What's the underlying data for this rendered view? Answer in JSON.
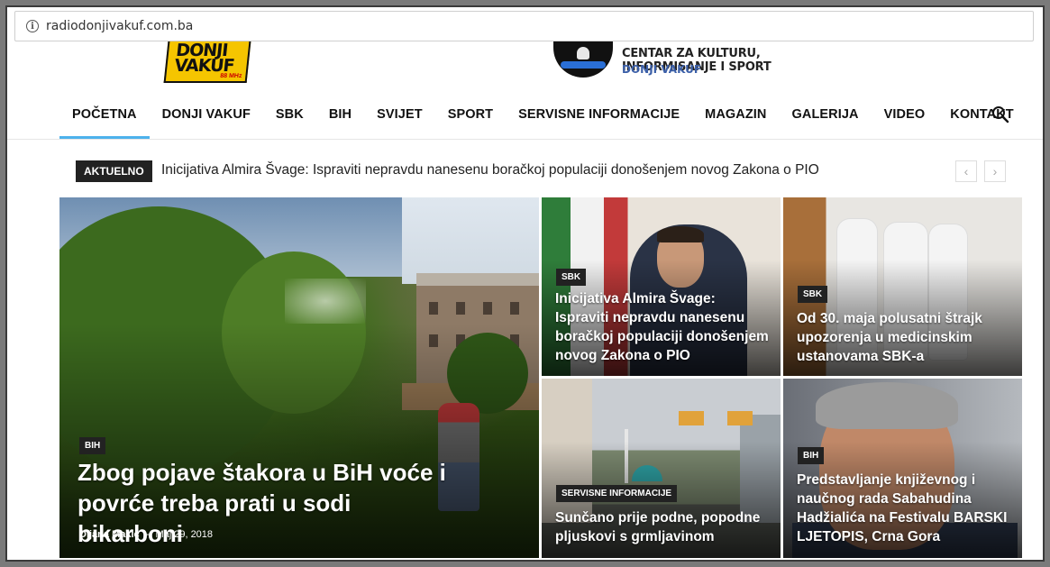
{
  "browser": {
    "url": "radiodonjivakuf.com.ba"
  },
  "header": {
    "logo_left": {
      "line1": "DONJI",
      "line2": "VAKUF",
      "freq": "88 MHz"
    },
    "logo_right": {
      "line1": "CENTAR ZA KULTURU, INFORMISANJE I SPORT",
      "line2": "DONJI VAKUF"
    }
  },
  "nav": {
    "items": [
      "POČETNA",
      "DONJI VAKUF",
      "SBK",
      "BIH",
      "SVIJET",
      "SPORT",
      "SERVISNE INFORMACIJE",
      "MAGAZIN",
      "GALERIJA",
      "VIDEO",
      "KONTAKT"
    ],
    "active": "POČETNA",
    "search_icon": "search-icon"
  },
  "ticker": {
    "badge": "AKTUELNO",
    "text": "Inicijativa Almira Švage: Ispraviti nepravdu nanesenu boračkoj populaciji donošenjem novog Zakona o PIO",
    "prev": "‹",
    "next": "›"
  },
  "articles": [
    {
      "category": "BIH",
      "title": "Zbog pojave štakora u BiH voće i povrće treba prati u sodi bikarboni",
      "author": "Dijana Makić",
      "separator": "-",
      "date": "Maj 29, 2018"
    },
    {
      "category": "SBK",
      "title": "Inicijativa Almira Švage: Ispraviti nepravdu nanesenu boračkoj populaciji donošenjem novog Zakona o PIO"
    },
    {
      "category": "SBK",
      "title": "Od 30. maja polusatni štrajk upozorenja u medicinskim ustanovama SBK-a"
    },
    {
      "category": "SERVISNE INFORMACIJE",
      "title": "Sunčano prije podne, popodne pljuskovi s grmljavinom"
    },
    {
      "category": "BIH",
      "title": "Predstavljanje književnog i naučnog rada Sabahudina Hadžialića na Festivalu BARSKI LJETOPIS, Crna Gora"
    }
  ],
  "colors": {
    "accent": "#4db2ec",
    "badge_bg": "#222222"
  }
}
